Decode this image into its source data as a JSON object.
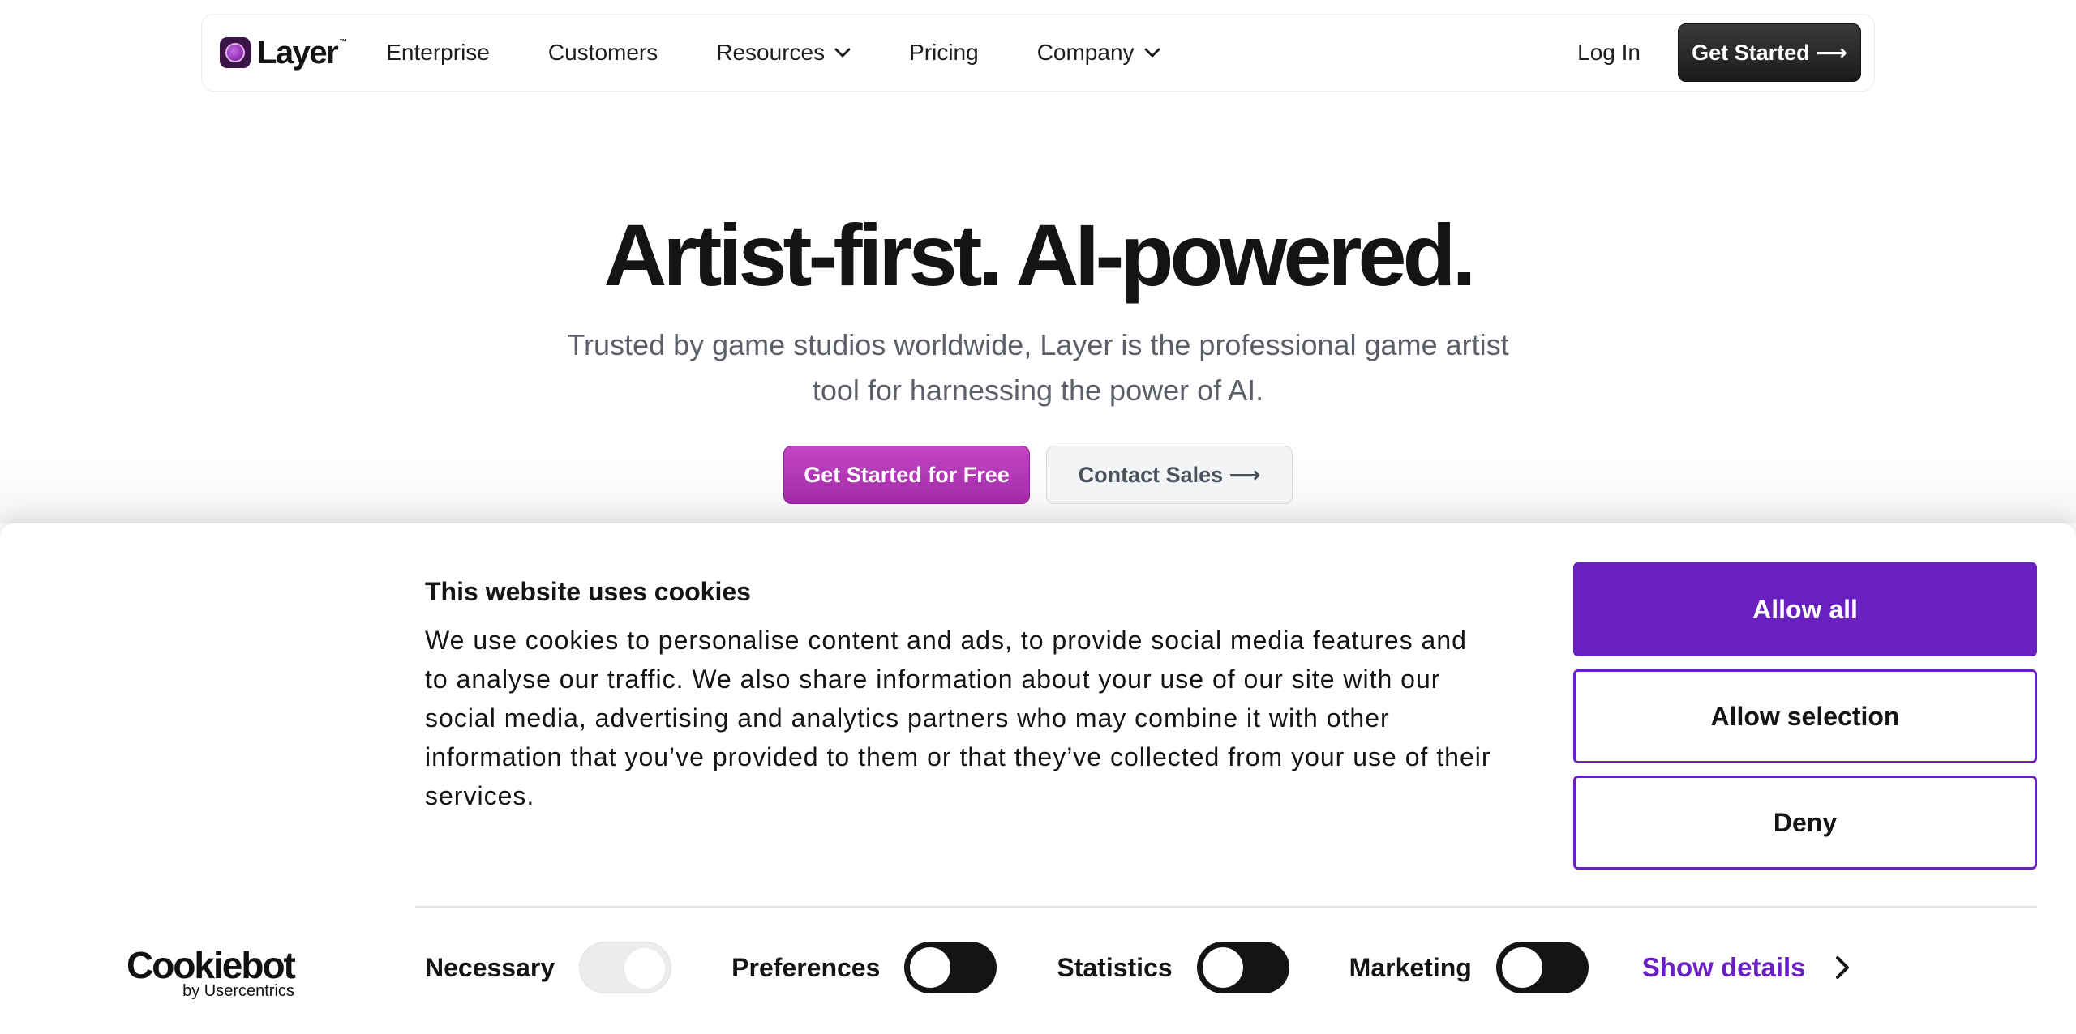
{
  "nav": {
    "logo_text": "Layer",
    "logo_tm": "™",
    "items": [
      {
        "label": "Enterprise",
        "dropdown": false
      },
      {
        "label": "Customers",
        "dropdown": false
      },
      {
        "label": "Resources",
        "dropdown": true
      },
      {
        "label": "Pricing",
        "dropdown": false
      },
      {
        "label": "Company",
        "dropdown": true
      }
    ],
    "login_label": "Log In",
    "cta_label": "Get Started ⟶"
  },
  "hero": {
    "title": "Artist-first. AI-powered.",
    "subtitle": "Trusted by game studios worldwide, Layer is the professional game artist tool for harnessing the power of AI.",
    "primary_cta": "Get Started for Free",
    "secondary_cta": "Contact Sales ⟶"
  },
  "cookie_banner": {
    "title": "This website uses cookies",
    "body": "We use cookies to personalise content and ads, to provide social media features and to analyse our traffic. We also share information about your use of our site with our social media, advertising and analytics partners who may combine it with other information that you’ve provided to them or that they’ve collected from your use of their services.",
    "allow_all": "Allow all",
    "allow_selection": "Allow selection",
    "deny": "Deny",
    "brand_name": "Cookiebot",
    "brand_by": "by Usercentrics",
    "toggles": [
      {
        "label": "Necessary",
        "state": "on",
        "disabled": true
      },
      {
        "label": "Preferences",
        "state": "off",
        "disabled": false
      },
      {
        "label": "Statistics",
        "state": "off",
        "disabled": false
      },
      {
        "label": "Marketing",
        "state": "off",
        "disabled": false
      }
    ],
    "show_details": "Show details"
  },
  "colors": {
    "accent_purple": "#6a1fc1",
    "primary_magenta": "#b236b8",
    "text_dark": "#141414",
    "text_muted": "#5b5f68"
  }
}
